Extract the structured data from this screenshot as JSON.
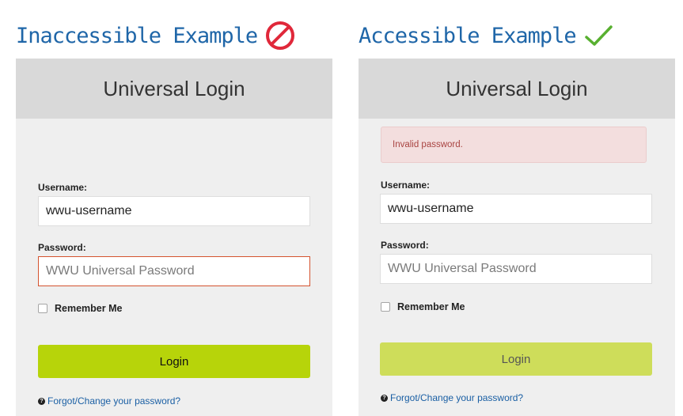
{
  "left": {
    "heading": "Inaccessible Example",
    "status_icon": "prohibited-icon",
    "status_color": "#e0283a",
    "panel_title": "Universal Login",
    "username_label": "Username:",
    "username_value": "wwu-username",
    "password_label": "Password:",
    "password_placeholder": "WWU Universal Password",
    "remember_label": "Remember Me",
    "login_label": "Login",
    "forgot_label": "Forgot/Change your password?"
  },
  "right": {
    "heading": "Accessible Example",
    "status_icon": "checkmark-icon",
    "status_color": "#58b030",
    "panel_title": "Universal Login",
    "error_message": "Invalid password.",
    "username_label": "Username:",
    "username_value": "wwu-username",
    "password_label": "Password:",
    "password_placeholder": "WWU Universal Password",
    "remember_label": "Remember Me",
    "login_label": "Login",
    "forgot_label": "Forgot/Change your password?"
  },
  "colors": {
    "heading": "#1f66a8",
    "login_active": "#b7d40a",
    "login_muted": "#cedd5a",
    "error_border": "#d4532f",
    "alert_background": "#f3dede",
    "alert_text": "#a94442",
    "link": "#1a5fa4"
  }
}
